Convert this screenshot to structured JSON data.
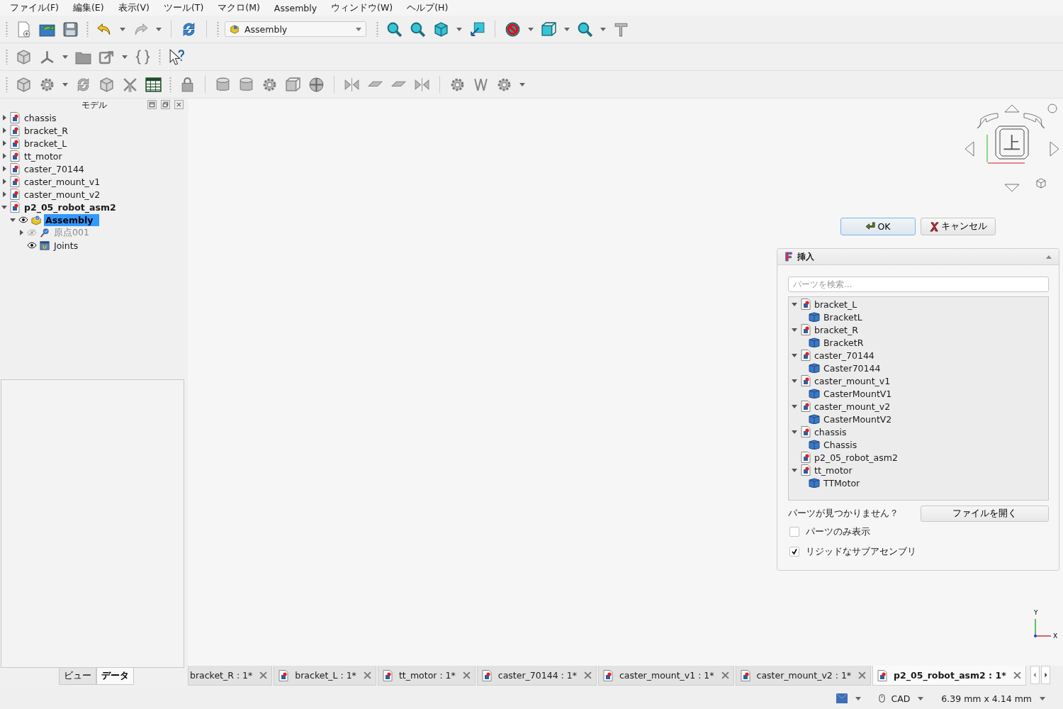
{
  "menu": [
    "ファイル(F)",
    "編集(E)",
    "表示(V)",
    "ツール(T)",
    "マクロ(M)",
    "Assembly",
    "ウィンドウ(W)",
    "ヘルプ(H)"
  ],
  "workbench": "Assembly",
  "model_panel": {
    "title": "モデル",
    "tree": [
      {
        "label": "chassis",
        "expanded": false,
        "active": false,
        "selected": false
      },
      {
        "label": "bracket_R",
        "expanded": false,
        "active": false,
        "selected": false
      },
      {
        "label": "bracket_L",
        "expanded": false,
        "active": false,
        "selected": false
      },
      {
        "label": "tt_motor",
        "expanded": false,
        "active": false,
        "selected": false
      },
      {
        "label": "caster_70144",
        "expanded": false,
        "active": false,
        "selected": false
      },
      {
        "label": "caster_mount_v1",
        "expanded": false,
        "active": false,
        "selected": false
      },
      {
        "label": "caster_mount_v2",
        "expanded": false,
        "active": false,
        "selected": false
      },
      {
        "label": "p2_05_robot_asm2",
        "expanded": true,
        "active": true,
        "selected": false,
        "children": [
          {
            "label": "Assembly",
            "kind": "assembly",
            "expanded": true,
            "visible": true,
            "selected": true,
            "children": [
              {
                "label": "原点001",
                "kind": "origin",
                "expanded": false,
                "visible": false,
                "selected": false
              },
              {
                "label": "Joints",
                "kind": "joints",
                "visible": true,
                "selected": false
              }
            ]
          }
        ]
      }
    ],
    "tabs": [
      {
        "label": "ビュー",
        "selected": false
      },
      {
        "label": "データ",
        "selected": true
      }
    ]
  },
  "view": {
    "navcube_face": "上",
    "axis_y": "Y",
    "axis_x": "X"
  },
  "dialog_buttons": [
    {
      "label": "OK",
      "kind": "ok"
    },
    {
      "label": "キャンセル",
      "kind": "cancel"
    }
  ],
  "insert_panel": {
    "title": "挿入",
    "search": {
      "placeholder": "パーツを検索..."
    },
    "parts": [
      {
        "label": "bracket_L",
        "expanded": true,
        "children": [
          {
            "label": "BracketL"
          }
        ]
      },
      {
        "label": "bracket_R",
        "expanded": true,
        "children": [
          {
            "label": "BracketR"
          }
        ]
      },
      {
        "label": "caster_70144",
        "expanded": true,
        "children": [
          {
            "label": "Caster70144"
          }
        ]
      },
      {
        "label": "caster_mount_v1",
        "expanded": true,
        "children": [
          {
            "label": "CasterMountV1"
          }
        ]
      },
      {
        "label": "caster_mount_v2",
        "expanded": true,
        "children": [
          {
            "label": "CasterMountV2"
          }
        ]
      },
      {
        "label": "chassis",
        "expanded": true,
        "children": [
          {
            "label": "Chassis"
          }
        ]
      },
      {
        "label": "p2_05_robot_asm2"
      },
      {
        "label": "tt_motor",
        "expanded": true,
        "children": [
          {
            "label": "TTMotor"
          }
        ]
      }
    ],
    "missing_label": "パーツが見つかりません？",
    "open_button": "ファイルを開く",
    "options": [
      {
        "label": "パーツのみ表示",
        "checked": false
      },
      {
        "label": "リジッドなサブアセンブリ",
        "checked": true
      }
    ]
  },
  "document_tabs": [
    {
      "label": "bracket_R : 1*",
      "selected": false,
      "clipped": true
    },
    {
      "label": "bracket_L : 1*",
      "selected": false,
      "clipped": false
    },
    {
      "label": "tt_motor : 1*",
      "selected": false,
      "clipped": false
    },
    {
      "label": "caster_70144 : 1*",
      "selected": false,
      "clipped": false
    },
    {
      "label": "caster_mount_v1 : 1*",
      "selected": false,
      "clipped": false
    },
    {
      "label": "caster_mount_v2 : 1*",
      "selected": false,
      "clipped": false
    },
    {
      "label": "p2_05_robot_asm2 : 1*",
      "selected": true,
      "clipped": false
    }
  ],
  "status_bar": {
    "navigation_style": "CAD",
    "dimensions": "6.39 mm x 4.14 mm"
  }
}
